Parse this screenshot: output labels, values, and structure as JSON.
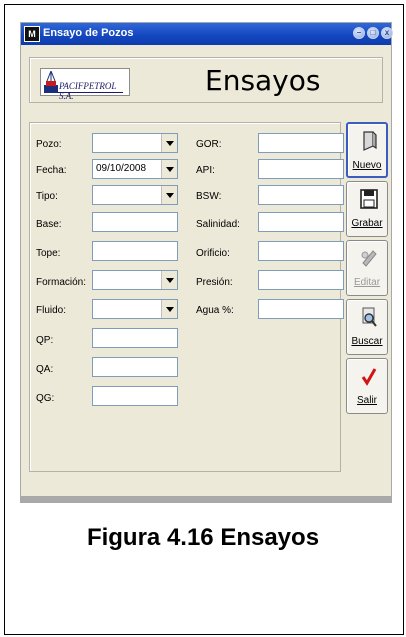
{
  "window": {
    "title": "Ensayo de Pozos",
    "controls": [
      "minimize",
      "maximize",
      "close"
    ]
  },
  "header": {
    "logo_text": "PACIFPETROL S.A.",
    "title": "Ensayos"
  },
  "left_fields": [
    {
      "label": "Pozo:",
      "type": "combo",
      "value": ""
    },
    {
      "label": "Fecha:",
      "type": "combo",
      "value": "09/10/2008"
    },
    {
      "label": "Tipo:",
      "type": "combo",
      "value": ""
    },
    {
      "label": "Base:",
      "type": "text",
      "value": ""
    },
    {
      "label": "Tope:",
      "type": "text",
      "value": ""
    },
    {
      "label": "Formación:",
      "type": "combo",
      "value": ""
    },
    {
      "label": "Fluido:",
      "type": "combo",
      "value": ""
    },
    {
      "label": "QP:",
      "type": "text",
      "value": ""
    },
    {
      "label": "QA:",
      "type": "text",
      "value": ""
    },
    {
      "label": "QG:",
      "type": "text",
      "value": ""
    }
  ],
  "right_fields": [
    {
      "label": "GOR:",
      "value": ""
    },
    {
      "label": "API:",
      "value": ""
    },
    {
      "label": "BSW:",
      "value": ""
    },
    {
      "label": "Salinidad:",
      "value": ""
    },
    {
      "label": "Orificio:",
      "value": ""
    },
    {
      "label": "Presión:",
      "value": ""
    },
    {
      "label": "Agua %:",
      "value": ""
    }
  ],
  "buttons": [
    {
      "label": "Nuevo",
      "icon": "new-document-icon",
      "enabled": true
    },
    {
      "label": "Grabar",
      "icon": "floppy-disk-icon",
      "enabled": true
    },
    {
      "label": "Editar",
      "icon": "edit-icon",
      "enabled": false
    },
    {
      "label": "Buscar",
      "icon": "search-icon",
      "enabled": true
    },
    {
      "label": "Salir",
      "icon": "checkmark-icon",
      "enabled": true
    }
  ],
  "caption": "Figura 4.16 Ensayos"
}
